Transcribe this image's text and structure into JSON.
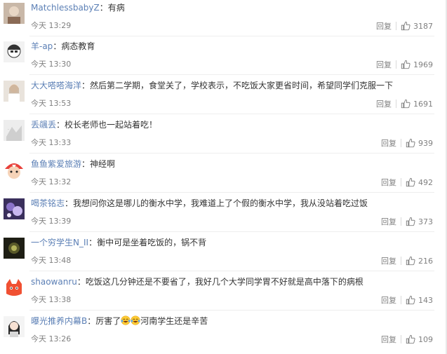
{
  "comments": [
    {
      "user": "MatchlessbabyZ",
      "text": "有病",
      "time": "今天 13:29",
      "reply": "回复",
      "likes": "3187"
    },
    {
      "user": "羊-ap",
      "text": "病态教育",
      "time": "今天 13:30",
      "reply": "回复",
      "likes": "1969"
    },
    {
      "user": "大大嗒嗒海洋",
      "text": "然后第二学期，食堂关了，学校表示，不吃饭大家更省时间，希望同学们克服一下",
      "time": "今天 13:53",
      "reply": "回复",
      "likes": "1691"
    },
    {
      "user": "丢飊丢",
      "text": "校长老师也一起站着吃！",
      "time": "今天 13:33",
      "reply": "回复",
      "likes": "939"
    },
    {
      "user": "鱼鱼紫爱旅游",
      "text": "神经啊",
      "time": "今天 13:32",
      "reply": "回复",
      "likes": "492"
    },
    {
      "user": "喝茶铭志",
      "text": "我想问你这是哪儿的衡水中学，我难道上了个假的衡水中学，我从没站着吃过饭",
      "time": "今天 13:39",
      "reply": "回复",
      "likes": "373"
    },
    {
      "user": "一个穷学生N_II",
      "text": "衡中可是坐着吃饭的，锅不背",
      "time": "今天 13:48",
      "reply": "回复",
      "likes": "216"
    },
    {
      "user": "shaowanru",
      "text": "吃饭这几分钟还是不要省了，我好几个大学同学胃不好就是高中落下的病根",
      "time": "今天 13:38",
      "reply": "回复",
      "likes": "143"
    },
    {
      "user": "曝光推养内幕B",
      "text_before": "厉害了",
      "text_after": "河南学生还是辛苦",
      "time": "今天 13:26",
      "reply": "回复",
      "likes": "109"
    }
  ],
  "colon": "：",
  "colors": {
    "username": "#eb7350",
    "username_alt": "#5b7fb5",
    "meta": "#808080",
    "text": "#333333"
  }
}
